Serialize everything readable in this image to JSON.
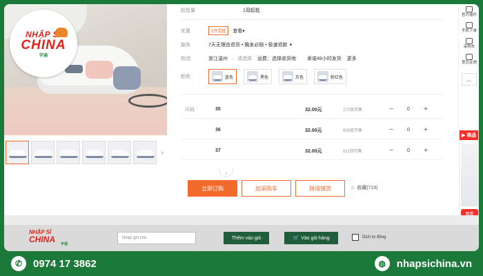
{
  "brand": {
    "logo_top": "NHẬP SỈ",
    "logo_main": "CHINA",
    "logo_sub": "宇涵"
  },
  "product": {
    "moq_label": "起批量",
    "moq_value": "1双起批",
    "offer_label": "优惠",
    "offer_tag": "1件混批",
    "offer_link": "查看",
    "service_label": "服务",
    "service_value": "7天无理由退货 • 晚发必赔 • 极速退款",
    "logistics_label": "物流",
    "logistics_from": "浙江温州",
    "logistics_to": "请选择",
    "logistics_fee": "运费：选择收货地",
    "logistics_ship": "承诺48小时发货",
    "logistics_more": "更多",
    "color_label": "颜色",
    "colors": [
      "蓝色",
      "黑色",
      "灰色",
      "粉红色"
    ],
    "selected_color": "蓝色",
    "size_label": "尺码",
    "sizes": [
      {
        "name": "35",
        "price": "32.00元",
        "stock": "270双可售",
        "qty": "0"
      },
      {
        "name": "36",
        "price": "32.00元",
        "stock": "609双可售",
        "qty": "0"
      },
      {
        "name": "37",
        "price": "32.00元",
        "stock": "811双可售",
        "qty": "0"
      }
    ],
    "btn_order": "立即订购",
    "btn_cart": "加采购车",
    "btn_cross": "跨境铺货",
    "fav": "收藏(719)"
  },
  "sidebar": {
    "items": [
      "官方插件",
      "手机下单",
      "采购车",
      "意见反馈"
    ],
    "live_title": "商品",
    "live_btn": "观看"
  },
  "toolbar": {
    "note_placeholder": "Nhập ghi chú",
    "add_btn": "Thêm vào giỏ",
    "cart_btn": "Vào giỏ hàng",
    "auto_translate": "Dịch tự động"
  },
  "footer": {
    "phone": "0974 17 3862",
    "website": "nhapsichina.vn"
  },
  "colors_theme": {
    "accent": "#f36b2c",
    "brand_green": "#1b7a3a",
    "brand_red": "#e2231a"
  }
}
